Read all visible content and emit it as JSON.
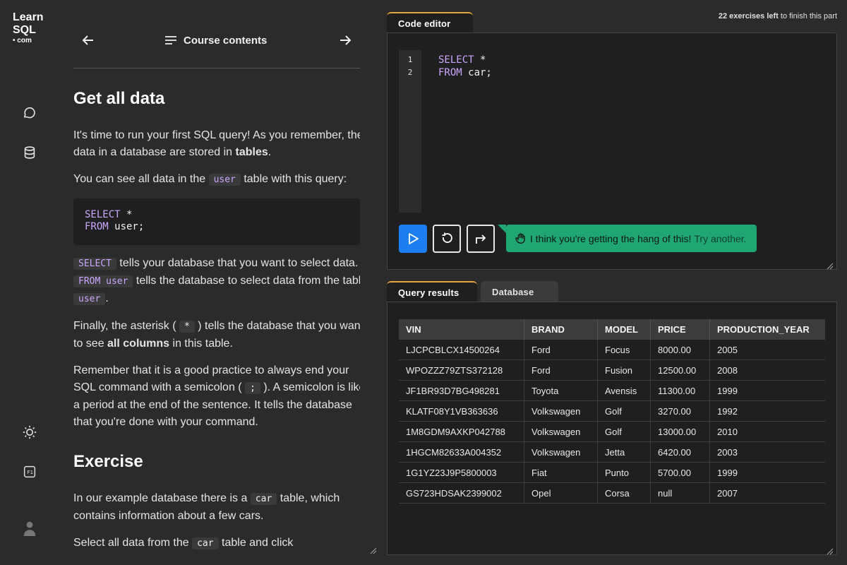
{
  "logo": {
    "line1": "Learn",
    "line2": "SQL",
    "line3": "• com"
  },
  "sidebar": {
    "icons": [
      "chat-icon",
      "database-icon",
      "theme-sun-icon",
      "keyboard-f1-icon",
      "avatar"
    ]
  },
  "nav": {
    "course_label": "Course contents"
  },
  "lesson": {
    "title": "Get all data",
    "p1_a": "It's time to run your first SQL query! As you remember, the data in a database are stored in ",
    "p1_b": "tables",
    "p1_c": ".",
    "p2_a": "You can see all data in the ",
    "p2_code": "user",
    "p2_b": " table with this query:",
    "code_line1_kw": "SELECT",
    "code_line1_rest": " *",
    "code_line2_kw": "FROM",
    "code_line2_rest": " user;",
    "p3_code1": "SELECT",
    "p3_a": " tells your database that you want to select data. ",
    "p3_code2": "FROM user",
    "p3_b": " tells the database to select data from the table ",
    "p3_code3": "user",
    "p3_c": ".",
    "p4_a": "Finally, the asterisk ( ",
    "p4_code": "*",
    "p4_b": " ) tells the database that you want to see ",
    "p4_bold": "all columns",
    "p4_c": " in this table.",
    "p5_a": "Remember that it is a good practice to always end your SQL command with a semicolon ( ",
    "p5_code": ";",
    "p5_b": " ). A semicolon is like a period at the end of the sentence. It tells the database that you're done with your command.",
    "exercise_title": "Exercise",
    "p6_a": "In our example database there is a ",
    "p6_code": "car",
    "p6_b": " table, which contains information about a few cars.",
    "p7_a": "Select all data from the ",
    "p7_code": "car",
    "p7_b": " table and click"
  },
  "exercises": {
    "count_bold": "22 exercises left",
    "rest": " to finish this part"
  },
  "editor": {
    "tab_label": "Code editor",
    "line_numbers": [
      "1",
      "2"
    ],
    "line1_kw": "SELECT",
    "line1_rest": " *",
    "line2_kw": "FROM",
    "line2_rest": " car;",
    "hint_msg": "I think you're getting the hang of this!",
    "hint_try": "Try another."
  },
  "results": {
    "tab_results": "Query results",
    "tab_database": "Database",
    "columns": [
      "VIN",
      "BRAND",
      "MODEL",
      "PRICE",
      "PRODUCTION_YEAR"
    ],
    "rows": [
      [
        "LJCPCBLCX14500264",
        "Ford",
        "Focus",
        "8000.00",
        "2005"
      ],
      [
        "WPOZZZ79ZTS372128",
        "Ford",
        "Fusion",
        "12500.00",
        "2008"
      ],
      [
        "JF1BR93D7BG498281",
        "Toyota",
        "Avensis",
        "11300.00",
        "1999"
      ],
      [
        "KLATF08Y1VB363636",
        "Volkswagen",
        "Golf",
        "3270.00",
        "1992"
      ],
      [
        "1M8GDM9AXKP042788",
        "Volkswagen",
        "Golf",
        "13000.00",
        "2010"
      ],
      [
        "1HGCM82633A004352",
        "Volkswagen",
        "Jetta",
        "6420.00",
        "2003"
      ],
      [
        "1G1YZ23J9P5800003",
        "Fiat",
        "Punto",
        "5700.00",
        "1999"
      ],
      [
        "GS723HDSAK2399002",
        "Opel",
        "Corsa",
        "null",
        "2007"
      ]
    ]
  }
}
